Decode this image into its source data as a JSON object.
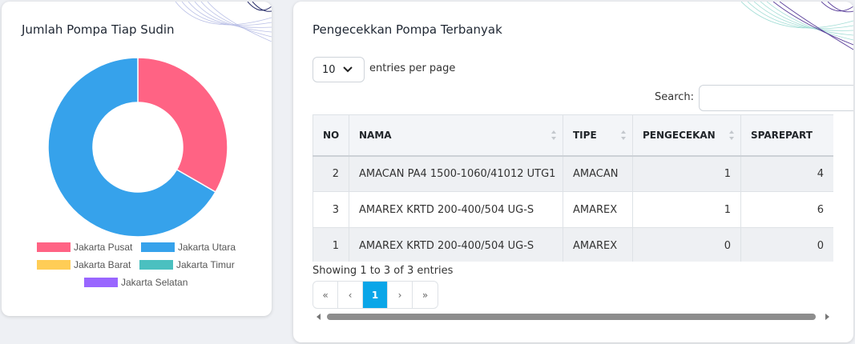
{
  "left_card": {
    "title": "Jumlah Pompa Tiap Sudin",
    "legend": [
      {
        "label": "Jakarta Pusat",
        "color": "#ff6384"
      },
      {
        "label": "Jakarta Utara",
        "color": "#36a2eb"
      },
      {
        "label": "Jakarta Barat",
        "color": "#ffcd56"
      },
      {
        "label": "Jakarta Timur",
        "color": "#4bc0c0"
      },
      {
        "label": "Jakarta Selatan",
        "color": "#9966ff"
      }
    ]
  },
  "chart_data": {
    "type": "pie",
    "categories": [
      "Jakarta Pusat",
      "Jakarta Utara",
      "Jakarta Barat",
      "Jakarta Timur",
      "Jakarta Selatan"
    ],
    "values": [
      1,
      2,
      0,
      0,
      0
    ],
    "colors": [
      "#ff6384",
      "#36a2eb",
      "#ffcd56",
      "#4bc0c0",
      "#9966ff"
    ],
    "legend_position": "bottom",
    "donut": true
  },
  "right_card": {
    "title": "Pengecekkan Pompa Terbanyak",
    "entries_value": "10",
    "entries_label": "entries per page",
    "search_label": "Search:",
    "search_value": "",
    "columns": [
      "NO",
      "NAMA",
      "TIPE",
      "PENGECEKAN",
      "SPAREPART"
    ],
    "rows": [
      [
        "2",
        "AMACAN PA4 1500-1060/41012 UTG1",
        "AMACAN",
        "1",
        "4"
      ],
      [
        "3",
        "AMAREX KRTD 200-400/504 UG-S",
        "AMAREX",
        "1",
        "6"
      ],
      [
        "1",
        "AMAREX KRTD 200-400/504 UG-S",
        "AMAREX",
        "0",
        "0"
      ]
    ],
    "info": "Showing 1 to 3 of 3 entries",
    "pagination": {
      "first": "«",
      "prev": "‹",
      "current": "1",
      "next": "›",
      "last": "»"
    }
  }
}
